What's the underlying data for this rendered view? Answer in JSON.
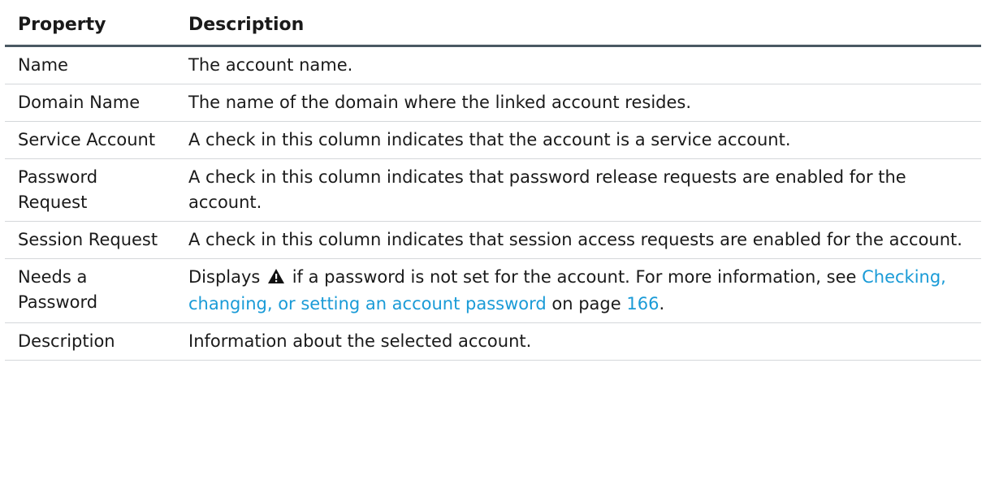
{
  "table": {
    "headers": {
      "property": "Property",
      "description": "Description"
    },
    "rows": [
      {
        "property": "Name",
        "description": "The account name."
      },
      {
        "property": "Domain Name",
        "description": "The name of the domain where the linked account resides."
      },
      {
        "property": "Service Account",
        "description": "A check in this column indicates that the account is a service account."
      },
      {
        "property": "Password Request",
        "description": "A check in this column indicates that password release requests are enabled for the account."
      },
      {
        "property": "Session Request",
        "description": "A check in this column indicates that session access requests are enabled for the account."
      },
      {
        "property": "Needs a Password",
        "description_parts": {
          "before_icon": "Displays",
          "icon": "warning-icon",
          "after_icon": " if a password is not set for the account. For more information, see ",
          "link_text": "Checking, changing, or setting an account password",
          "middle": " on page ",
          "page_link": "166",
          "end": "."
        }
      },
      {
        "property": "Description",
        "description": "Information about the selected account."
      }
    ]
  },
  "colors": {
    "link": "#1a9bd7",
    "header_rule": "#4a5963",
    "row_rule": "#d4d7da"
  }
}
